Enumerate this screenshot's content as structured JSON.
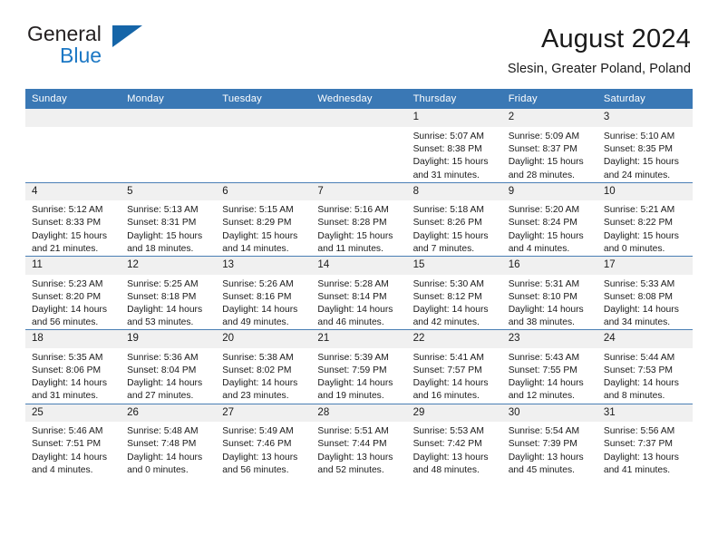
{
  "brand": {
    "name_top": "General",
    "name_bottom": "Blue",
    "triangle_icon": "triangle-icon",
    "accent_color": "#1b77c4"
  },
  "header": {
    "title": "August 2024",
    "subtitle": "Slesin, Greater Poland, Poland"
  },
  "calendar": {
    "header_bg": "#3a78b5",
    "daynum_bg": "#f0f0f0",
    "weekday_headers": [
      "Sunday",
      "Monday",
      "Tuesday",
      "Wednesday",
      "Thursday",
      "Friday",
      "Saturday"
    ],
    "weeks": [
      [
        {
          "day": "",
          "blank": true,
          "lines": []
        },
        {
          "day": "",
          "blank": true,
          "lines": []
        },
        {
          "day": "",
          "blank": true,
          "lines": []
        },
        {
          "day": "",
          "blank": true,
          "lines": []
        },
        {
          "day": "1",
          "lines": [
            "Sunrise: 5:07 AM",
            "Sunset: 8:38 PM",
            "Daylight: 15 hours",
            "and 31 minutes."
          ]
        },
        {
          "day": "2",
          "lines": [
            "Sunrise: 5:09 AM",
            "Sunset: 8:37 PM",
            "Daylight: 15 hours",
            "and 28 minutes."
          ]
        },
        {
          "day": "3",
          "lines": [
            "Sunrise: 5:10 AM",
            "Sunset: 8:35 PM",
            "Daylight: 15 hours",
            "and 24 minutes."
          ]
        }
      ],
      [
        {
          "day": "4",
          "lines": [
            "Sunrise: 5:12 AM",
            "Sunset: 8:33 PM",
            "Daylight: 15 hours",
            "and 21 minutes."
          ]
        },
        {
          "day": "5",
          "lines": [
            "Sunrise: 5:13 AM",
            "Sunset: 8:31 PM",
            "Daylight: 15 hours",
            "and 18 minutes."
          ]
        },
        {
          "day": "6",
          "lines": [
            "Sunrise: 5:15 AM",
            "Sunset: 8:29 PM",
            "Daylight: 15 hours",
            "and 14 minutes."
          ]
        },
        {
          "day": "7",
          "lines": [
            "Sunrise: 5:16 AM",
            "Sunset: 8:28 PM",
            "Daylight: 15 hours",
            "and 11 minutes."
          ]
        },
        {
          "day": "8",
          "lines": [
            "Sunrise: 5:18 AM",
            "Sunset: 8:26 PM",
            "Daylight: 15 hours",
            "and 7 minutes."
          ]
        },
        {
          "day": "9",
          "lines": [
            "Sunrise: 5:20 AM",
            "Sunset: 8:24 PM",
            "Daylight: 15 hours",
            "and 4 minutes."
          ]
        },
        {
          "day": "10",
          "lines": [
            "Sunrise: 5:21 AM",
            "Sunset: 8:22 PM",
            "Daylight: 15 hours",
            "and 0 minutes."
          ]
        }
      ],
      [
        {
          "day": "11",
          "lines": [
            "Sunrise: 5:23 AM",
            "Sunset: 8:20 PM",
            "Daylight: 14 hours",
            "and 56 minutes."
          ]
        },
        {
          "day": "12",
          "lines": [
            "Sunrise: 5:25 AM",
            "Sunset: 8:18 PM",
            "Daylight: 14 hours",
            "and 53 minutes."
          ]
        },
        {
          "day": "13",
          "lines": [
            "Sunrise: 5:26 AM",
            "Sunset: 8:16 PM",
            "Daylight: 14 hours",
            "and 49 minutes."
          ]
        },
        {
          "day": "14",
          "lines": [
            "Sunrise: 5:28 AM",
            "Sunset: 8:14 PM",
            "Daylight: 14 hours",
            "and 46 minutes."
          ]
        },
        {
          "day": "15",
          "lines": [
            "Sunrise: 5:30 AM",
            "Sunset: 8:12 PM",
            "Daylight: 14 hours",
            "and 42 minutes."
          ]
        },
        {
          "day": "16",
          "lines": [
            "Sunrise: 5:31 AM",
            "Sunset: 8:10 PM",
            "Daylight: 14 hours",
            "and 38 minutes."
          ]
        },
        {
          "day": "17",
          "lines": [
            "Sunrise: 5:33 AM",
            "Sunset: 8:08 PM",
            "Daylight: 14 hours",
            "and 34 minutes."
          ]
        }
      ],
      [
        {
          "day": "18",
          "lines": [
            "Sunrise: 5:35 AM",
            "Sunset: 8:06 PM",
            "Daylight: 14 hours",
            "and 31 minutes."
          ]
        },
        {
          "day": "19",
          "lines": [
            "Sunrise: 5:36 AM",
            "Sunset: 8:04 PM",
            "Daylight: 14 hours",
            "and 27 minutes."
          ]
        },
        {
          "day": "20",
          "lines": [
            "Sunrise: 5:38 AM",
            "Sunset: 8:02 PM",
            "Daylight: 14 hours",
            "and 23 minutes."
          ]
        },
        {
          "day": "21",
          "lines": [
            "Sunrise: 5:39 AM",
            "Sunset: 7:59 PM",
            "Daylight: 14 hours",
            "and 19 minutes."
          ]
        },
        {
          "day": "22",
          "lines": [
            "Sunrise: 5:41 AM",
            "Sunset: 7:57 PM",
            "Daylight: 14 hours",
            "and 16 minutes."
          ]
        },
        {
          "day": "23",
          "lines": [
            "Sunrise: 5:43 AM",
            "Sunset: 7:55 PM",
            "Daylight: 14 hours",
            "and 12 minutes."
          ]
        },
        {
          "day": "24",
          "lines": [
            "Sunrise: 5:44 AM",
            "Sunset: 7:53 PM",
            "Daylight: 14 hours",
            "and 8 minutes."
          ]
        }
      ],
      [
        {
          "day": "25",
          "lines": [
            "Sunrise: 5:46 AM",
            "Sunset: 7:51 PM",
            "Daylight: 14 hours",
            "and 4 minutes."
          ]
        },
        {
          "day": "26",
          "lines": [
            "Sunrise: 5:48 AM",
            "Sunset: 7:48 PM",
            "Daylight: 14 hours",
            "and 0 minutes."
          ]
        },
        {
          "day": "27",
          "lines": [
            "Sunrise: 5:49 AM",
            "Sunset: 7:46 PM",
            "Daylight: 13 hours",
            "and 56 minutes."
          ]
        },
        {
          "day": "28",
          "lines": [
            "Sunrise: 5:51 AM",
            "Sunset: 7:44 PM",
            "Daylight: 13 hours",
            "and 52 minutes."
          ]
        },
        {
          "day": "29",
          "lines": [
            "Sunrise: 5:53 AM",
            "Sunset: 7:42 PM",
            "Daylight: 13 hours",
            "and 48 minutes."
          ]
        },
        {
          "day": "30",
          "lines": [
            "Sunrise: 5:54 AM",
            "Sunset: 7:39 PM",
            "Daylight: 13 hours",
            "and 45 minutes."
          ]
        },
        {
          "day": "31",
          "lines": [
            "Sunrise: 5:56 AM",
            "Sunset: 7:37 PM",
            "Daylight: 13 hours",
            "and 41 minutes."
          ]
        }
      ]
    ]
  }
}
